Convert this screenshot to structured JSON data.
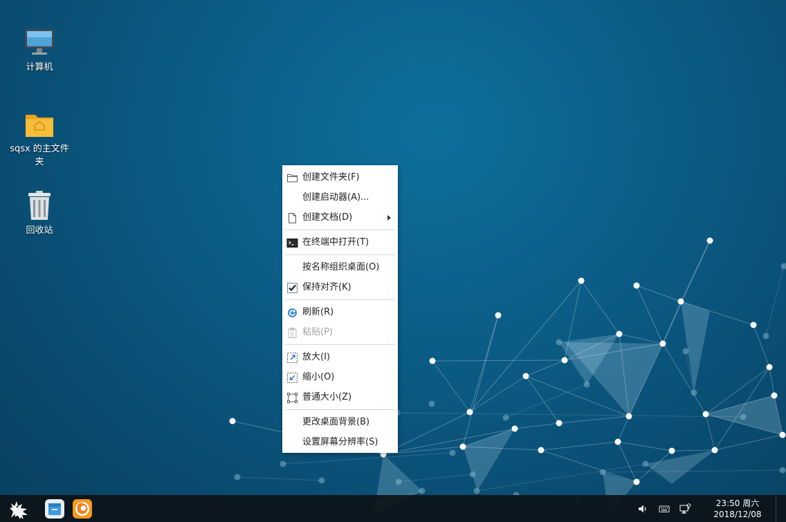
{
  "desktop": {
    "icons": [
      {
        "label": "计算机",
        "icon": "computer-icon"
      },
      {
        "label": "sqsx 的主文件夹",
        "icon": "home-folder-icon"
      },
      {
        "label": "回收站",
        "icon": "trash-icon"
      }
    ]
  },
  "context_menu": {
    "items": {
      "create_folder": {
        "label": "创建文件夹(F)",
        "icon": "folder-icon"
      },
      "create_launcher": {
        "label": "创建启动器(A)..."
      },
      "create_document": {
        "label": "创建文档(D)",
        "icon": "document-icon",
        "has_submenu": true
      },
      "open_terminal": {
        "label": "在终端中打开(T)",
        "icon": "terminal-icon"
      },
      "arrange_by_name": {
        "label": "按名称组织桌面(O)"
      },
      "keep_aligned": {
        "label": "保持对齐(K)",
        "icon": "checkbox-checked-icon",
        "checked": true
      },
      "refresh": {
        "label": "刷新(R)",
        "icon": "refresh-icon"
      },
      "paste": {
        "label": "粘贴(P)",
        "icon": "paste-icon",
        "disabled": true
      },
      "zoom_in": {
        "label": "放大(I)",
        "icon": "zoom-in-icon"
      },
      "zoom_out": {
        "label": "缩小(O)",
        "icon": "zoom-out-icon"
      },
      "normal_size": {
        "label": "普通大小(Z)",
        "icon": "normal-size-icon"
      },
      "change_background": {
        "label": "更改桌面背景(B)"
      },
      "screen_resolution": {
        "label": "设置屏幕分辨率(S)"
      }
    }
  },
  "taskbar": {
    "apps": [
      {
        "icon": "start-menu-icon"
      },
      {
        "icon": "file-manager-icon"
      },
      {
        "icon": "firefox-icon"
      }
    ],
    "tray": [
      "volume-icon",
      "keyboard-icon",
      "network-icon"
    ],
    "clock": {
      "time": "23:50 周六",
      "date": "2018/12/08"
    }
  },
  "colors": {
    "desktop_bg": "#0b5c86",
    "taskbar_bg": "#0c1218",
    "menu_bg": "#ffffff",
    "menu_disabled_text": "#a4a4a4"
  }
}
